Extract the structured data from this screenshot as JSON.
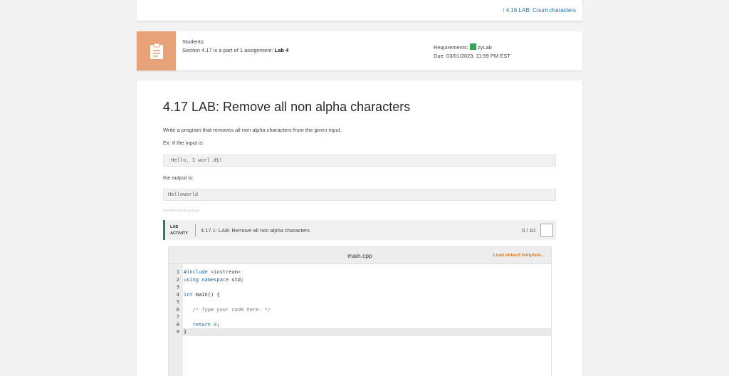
{
  "nav": {
    "prev_label": "4.16 LAB: Count characters"
  },
  "info": {
    "students_label": "Students:",
    "section_text": "Section 4.17 is a part of 1 assignment:",
    "assignment_name": "Lab 4",
    "requirements_label": "Requirements:",
    "requirement_name": "zyLab",
    "due_text": "Due: 03/01/2023, 11:59 PM EST"
  },
  "lab": {
    "title": "4.17 LAB: Remove all non alpha characters",
    "desc": "Write a program that removes all non alpha characters from the given input.",
    "example_intro": "Ex: If the input is:",
    "example_input": "-Hello, 1 worl d$!",
    "output_intro": "the output is:",
    "example_output": "Helloworld",
    "tiny_id": "451058.2170135.qx3zqy7",
    "activity_label_1": "LAB",
    "activity_label_2": "ACTIVITY",
    "activity_title": "4.17.1: LAB: Remove all non alpha characters",
    "score": "0 / 10"
  },
  "editor": {
    "filename": "main.cpp",
    "load_template": "Load default template...",
    "line_numbers": [
      "1",
      "2",
      "3",
      "4",
      "5",
      "6",
      "7",
      "8",
      "9"
    ]
  },
  "colors": {
    "accent_orange": "#e8a27a",
    "link_blue": "#1f6fb0",
    "zylab_green": "#3aa357",
    "load_orange": "#e07b24"
  }
}
